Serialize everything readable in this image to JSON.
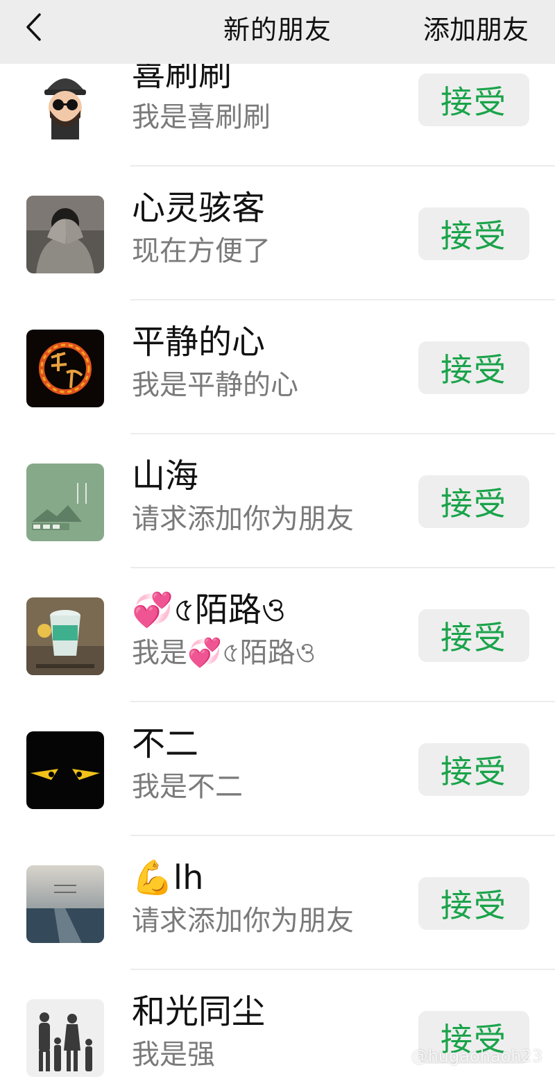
{
  "header": {
    "back_icon": "chevron-left-icon",
    "title": "新的朋友",
    "add_friend_label": "添加朋友"
  },
  "accent_color": "#1aa34a",
  "requests": [
    {
      "name": "喜刷刷",
      "message": "我是喜刷刷",
      "accept_label": "接受",
      "avatar": "cartoon-man-sunglasses"
    },
    {
      "name": "心灵骇客",
      "message": "现在方便了",
      "accept_label": "接受",
      "avatar": "person-hooded-photo"
    },
    {
      "name": "平静的心",
      "message": "我是平静的心",
      "accept_label": "接受",
      "avatar": "fire-ring-calligraphy"
    },
    {
      "name": "山海",
      "message": "请求添加你为朋友",
      "accept_label": "接受",
      "avatar": "green-mountain-poster"
    },
    {
      "name": "💞৫陌路ও",
      "message": "我是💞৫陌路ও",
      "accept_label": "接受",
      "avatar": "cup-photo"
    },
    {
      "name": "不二",
      "message": "我是不二",
      "accept_label": "接受",
      "avatar": "yellow-eyes-dark"
    },
    {
      "name": "💪lh",
      "message": "请求添加你为朋友",
      "accept_label": "接受",
      "avatar": "sea-horizon-photo"
    },
    {
      "name": "和光同尘",
      "message": "我是强",
      "accept_label": "接受",
      "avatar": "family-silhouette"
    }
  ],
  "watermark": "@hugaohaoh23"
}
